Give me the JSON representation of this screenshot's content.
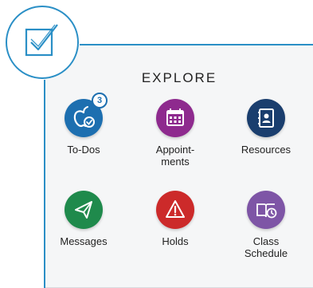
{
  "explore": {
    "title": "EXPLORE",
    "tiles": [
      {
        "label": "To-Dos",
        "color": "#1d6fb0",
        "icon": "apple-check-icon",
        "badge": "3"
      },
      {
        "label": "Appoint-\nments",
        "color": "#8e2a8e",
        "icon": "calendar-icon"
      },
      {
        "label": "Resources",
        "color": "#1a3e6e",
        "icon": "contact-book-icon"
      },
      {
        "label": "Messages",
        "color": "#1f8a4c",
        "icon": "paper-plane-icon"
      },
      {
        "label": "Holds",
        "color": "#cc2a2a",
        "icon": "warning-icon"
      },
      {
        "label": "Class\nSchedule",
        "color": "#7e55a6",
        "icon": "book-clock-icon"
      }
    ]
  },
  "colors": {
    "frame": "#2a8fc6"
  }
}
